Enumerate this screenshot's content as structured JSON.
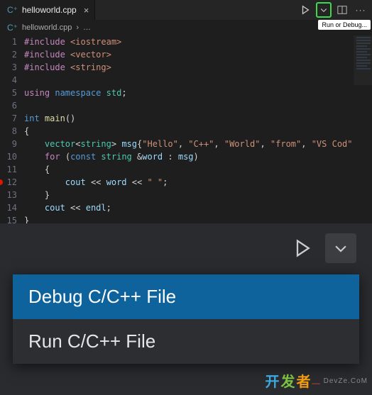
{
  "tab": {
    "filename": "helloworld.cpp"
  },
  "breadcrumb": {
    "filename": "helloworld.cpp"
  },
  "tooltip": {
    "run_or_debug": "Run or Debug..."
  },
  "code": {
    "lines": [
      {
        "n": 1,
        "kind": "include",
        "target": "<iostream>"
      },
      {
        "n": 2,
        "kind": "include",
        "target": "<vector>"
      },
      {
        "n": 3,
        "kind": "include",
        "target": "<string>"
      },
      {
        "n": 4,
        "kind": "blank"
      },
      {
        "n": 5,
        "kind": "using",
        "ns": "std"
      },
      {
        "n": 6,
        "kind": "blank"
      },
      {
        "n": 7,
        "kind": "main_sig",
        "ret": "int",
        "name": "main"
      },
      {
        "n": 8,
        "kind": "brace_open"
      },
      {
        "n": 9,
        "kind": "vector_decl",
        "type": "vector<string>",
        "name": "msg",
        "items": [
          "Hello",
          "C++",
          "World",
          "from",
          "VS Cod"
        ]
      },
      {
        "n": 10,
        "kind": "for",
        "decl": "const string &word",
        "in": "msg"
      },
      {
        "n": 11,
        "kind": "brace_open_indent"
      },
      {
        "n": 12,
        "kind": "cout_word",
        "sep": " "
      },
      {
        "n": 13,
        "kind": "brace_close_indent"
      },
      {
        "n": 14,
        "kind": "cout_endl"
      },
      {
        "n": 15,
        "kind": "brace_close"
      }
    ],
    "breakpoint_line": 12
  },
  "dropdown": {
    "items": [
      {
        "label": "Debug C/C++ File",
        "selected": true
      },
      {
        "label": "Run C/C++ File",
        "selected": false
      }
    ]
  },
  "watermark": {
    "chars": [
      "开",
      "发",
      "者",
      "_"
    ],
    "domain": "DevZe.CoM"
  }
}
